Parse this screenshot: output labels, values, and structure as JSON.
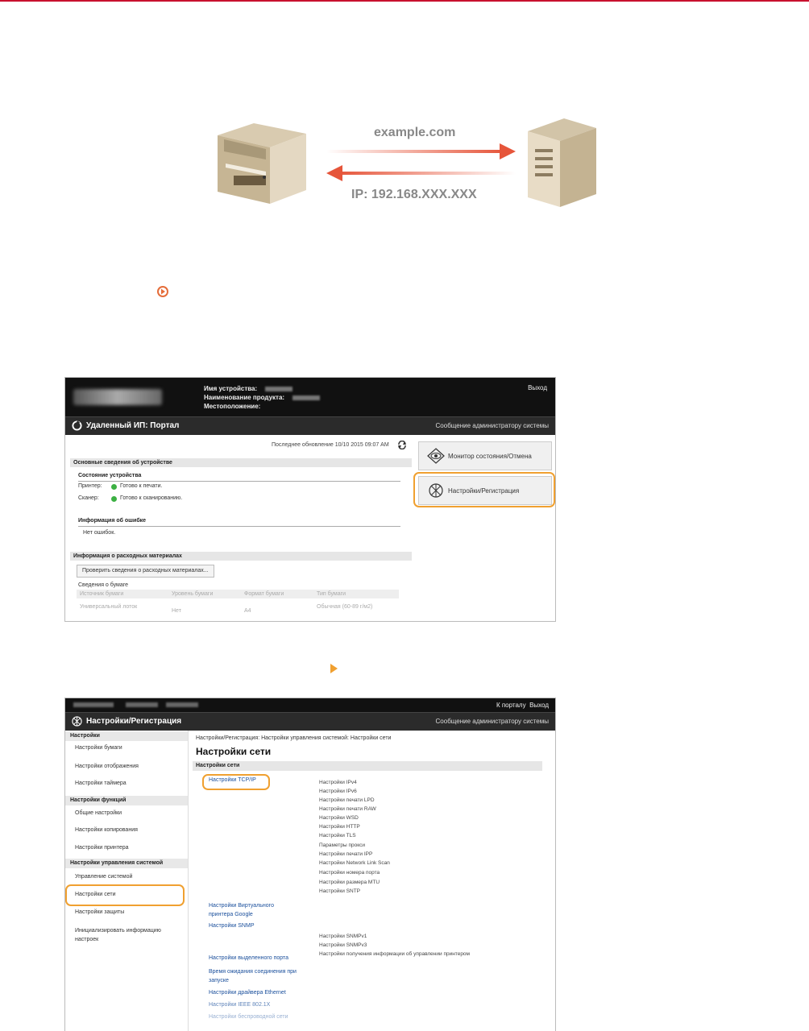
{
  "diagram": {
    "domain_label": "example.com",
    "ip_label": "IP: 192.168.XXX.XXX"
  },
  "portal": {
    "device_name_label": "Имя устройства:",
    "product_name_label": "Наименование продукта:",
    "location_label": "Местоположение:",
    "logout": "Выход",
    "title": "Удаленный ИП: Портал",
    "admin_message": "Сообщение администратору системы",
    "last_updated": "Последнее обновление 10/10 2015 09:07 AM",
    "basic_info": "Основные сведения об устройстве",
    "device_status": "Состояние устройства",
    "printer_label": "Принтер:",
    "printer_status": "Готово к печати.",
    "scanner_label": "Сканер:",
    "scanner_status": "Готово к сканированию.",
    "error_info": "Информация об ошибке",
    "no_errors": "Нет ошибок.",
    "consumables_info": "Информация о расходных материалах",
    "check_consumables_button": "Проверить сведения о расходных материалах...",
    "paper_info": "Сведения о бумаге",
    "paper_table": {
      "headers": [
        "Источник бумаги",
        "Уровень бумаги",
        "Формат бумаги",
        "Тип бумаги"
      ],
      "row": [
        "Универсальный лоток",
        "Нет",
        "A4",
        "Обычная (60-89 г/м2)"
      ]
    },
    "status_monitor_button": "Монитор состояния/Отмена",
    "settings_registration_button": "Настройки/Регистрация"
  },
  "settings": {
    "to_portal": "К порталу",
    "logout": "Выход",
    "title": "Настройки/Регистрация",
    "admin_message": "Сообщение администратору системы",
    "sidebar": {
      "sections": [
        {
          "title": "Настройки",
          "items": [
            "Настройки бумаги",
            "Настройки отображения",
            "Настройки таймера"
          ]
        },
        {
          "title": "Настройки функций",
          "items": [
            "Общие настройки",
            "Настройки копирования",
            "Настройки принтера"
          ]
        },
        {
          "title": "Настройки управления системой",
          "items": [
            "Управление системой",
            "Настройки сети",
            "Настройки защиты",
            "Инициализировать информацию настроек"
          ]
        }
      ]
    },
    "breadcrumb": "Настройки/Регистрация: Настройки управления системой: Настройки сети",
    "page_title": "Настройки сети",
    "section_header": "Настройки сети",
    "tcpip_link": "Настройки TCP/IP",
    "tcpip_subitems": [
      "Настройки IPv4",
      "Настройки IPv6",
      "Настройки печати LPD",
      "Настройки печати RAW",
      "Настройки WSD",
      "Настройки HTTP",
      "Настройки TLS",
      "Параметры прокси",
      "Настройки печати IPP",
      "Настройки Network Link Scan",
      "Настройки номера порта",
      "Настройки размера MTU",
      "Настройки SNTP"
    ],
    "google_link": "Настройки Виртуального принтера Google",
    "snmp_link": "Настройки SNMP",
    "snmp_subitems": [
      "Настройки SNMPv1",
      "Настройки SNMPv3",
      "Настройки получения информации об управлении принтером"
    ],
    "more_links": [
      "Настройки выделенного порта",
      "Время ожидания соединения при запуске",
      "Настройки драйвера Ethernet",
      "Настройки IEEE 802.1X",
      "Настройки беспроводной сети"
    ]
  }
}
